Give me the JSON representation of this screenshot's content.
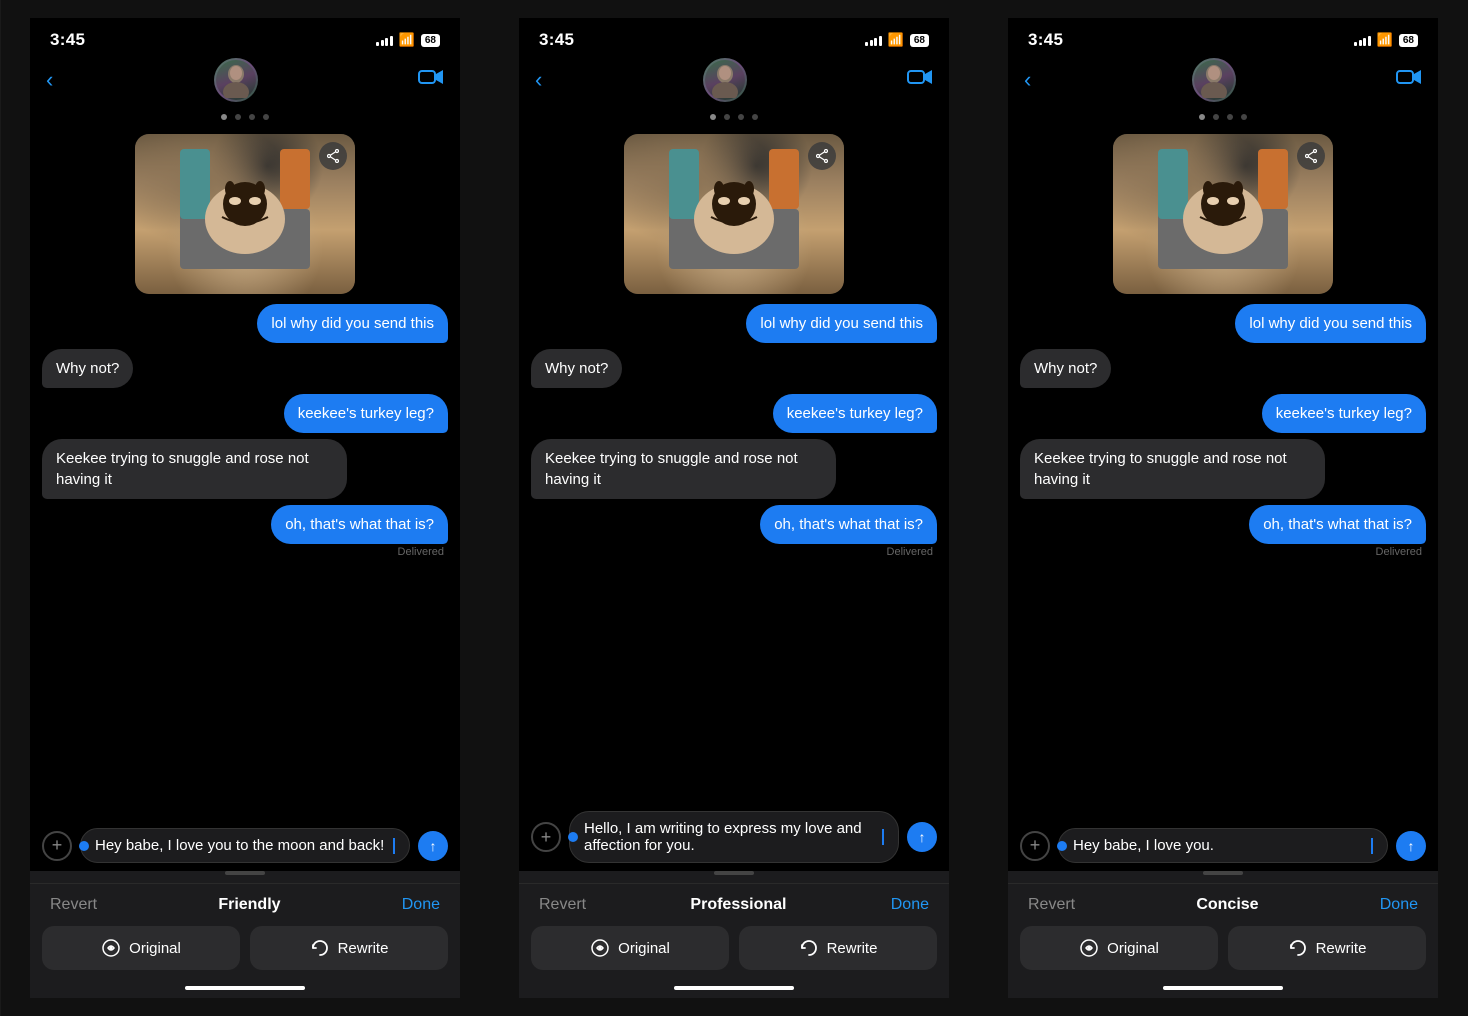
{
  "phones": [
    {
      "id": "phone1",
      "statusBar": {
        "time": "3:45",
        "battery": "68"
      },
      "catPhotoAlt": "Cat photo",
      "messages": [
        {
          "type": "sent",
          "text": "lol why did you send this"
        },
        {
          "type": "received",
          "text": "Why not?"
        },
        {
          "type": "sent",
          "text": "keekee's turkey leg?"
        },
        {
          "type": "received",
          "text": "Keekee trying to snuggle and rose not having it"
        },
        {
          "type": "sent",
          "text": "oh, that's what that is?",
          "delivered": true
        }
      ],
      "inputText": "Hey babe, I love you to the moon and back!",
      "bottomBar": {
        "revert": "Revert",
        "mode": "Friendly",
        "done": "Done",
        "originalLabel": "Original",
        "rewriteLabel": "Rewrite"
      }
    },
    {
      "id": "phone2",
      "statusBar": {
        "time": "3:45",
        "battery": "68"
      },
      "catPhotoAlt": "Cat photo",
      "messages": [
        {
          "type": "sent",
          "text": "lol why did you send this"
        },
        {
          "type": "received",
          "text": "Why not?"
        },
        {
          "type": "sent",
          "text": "keekee's turkey leg?"
        },
        {
          "type": "received",
          "text": "Keekee trying to snuggle and rose not having it"
        },
        {
          "type": "sent",
          "text": "oh, that's what that is?",
          "delivered": true
        }
      ],
      "inputText": "Hello,\nI am writing to express my love and affection for you.",
      "bottomBar": {
        "revert": "Revert",
        "mode": "Professional",
        "done": "Done",
        "originalLabel": "Original",
        "rewriteLabel": "Rewrite"
      }
    },
    {
      "id": "phone3",
      "statusBar": {
        "time": "3:45",
        "battery": "68"
      },
      "catPhotoAlt": "Cat photo",
      "messages": [
        {
          "type": "sent",
          "text": "lol why did you send this"
        },
        {
          "type": "received",
          "text": "Why not?"
        },
        {
          "type": "sent",
          "text": "keekee's turkey leg?"
        },
        {
          "type": "received",
          "text": "Keekee trying to snuggle and rose not having it"
        },
        {
          "type": "sent",
          "text": "oh, that's what that is?",
          "delivered": true
        }
      ],
      "inputText": "Hey babe, I love you.",
      "bottomBar": {
        "revert": "Revert",
        "mode": "Concise",
        "done": "Done",
        "originalLabel": "Original",
        "rewriteLabel": "Rewrite"
      }
    }
  ]
}
